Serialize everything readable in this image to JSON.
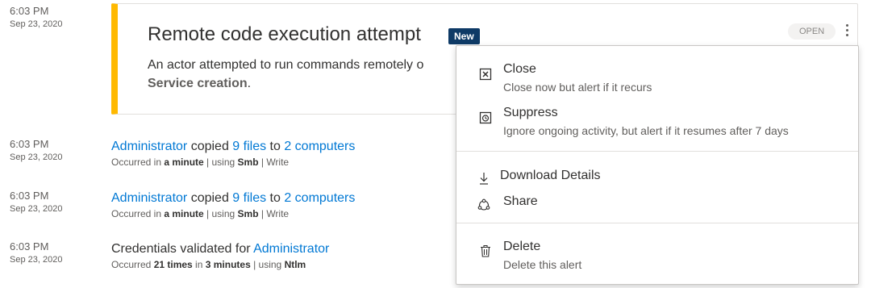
{
  "alert": {
    "time": "6:03 PM",
    "date": "Sep 23, 2020",
    "title": "Remote code execution attempt",
    "badge": "New",
    "description_visible": "An actor attempted to run commands remotely o",
    "description_bold": "Service creation",
    "description_end": ".",
    "status": "OPEN",
    "accent_color": "#ffb900"
  },
  "activities": [
    {
      "time": "6:03 PM",
      "date": "Sep 23, 2020",
      "actor": "Administrator",
      "verb": " copied ",
      "object1": "9 files",
      "mid": " to ",
      "object2": "2 computers",
      "sub_prefix": "Occurred in ",
      "sub_bold1": "a minute",
      "sub_mid": " | using ",
      "sub_bold2": "Smb",
      "sub_tail": " | Write"
    },
    {
      "time": "6:03 PM",
      "date": "Sep 23, 2020",
      "actor": "Administrator",
      "verb": " copied ",
      "object1": "9 files",
      "mid": " to ",
      "object2": "2 computers",
      "sub_prefix": "Occurred in ",
      "sub_bold1": "a minute",
      "sub_mid": " | using ",
      "sub_bold2": "Smb",
      "sub_tail": " | Write"
    },
    {
      "time": "6:03 PM",
      "date": "Sep 23, 2020",
      "text": "Credentials validated for ",
      "actor": "Administrator",
      "sub_prefix": "Occurred ",
      "sub_bold1": "21 times",
      "sub_mid": " in ",
      "sub_bold2": "3 minutes",
      "sub_mid2": " | using ",
      "sub_bold3": "Ntlm"
    }
  ],
  "menu": {
    "items": [
      {
        "icon": "close-box-icon",
        "label": "Close",
        "desc": "Close now but alert if it recurs"
      },
      {
        "icon": "suppress-icon",
        "label": "Suppress",
        "desc": "Ignore ongoing activity, but alert if it resumes after 7 days"
      },
      {
        "icon": "download-icon",
        "label": "Download Details"
      },
      {
        "icon": "share-icon",
        "label": "Share"
      },
      {
        "icon": "trash-icon",
        "label": "Delete",
        "desc": "Delete this alert"
      }
    ]
  },
  "colors": {
    "link": "#0078d4",
    "badge_bg": "#0e3a66"
  }
}
